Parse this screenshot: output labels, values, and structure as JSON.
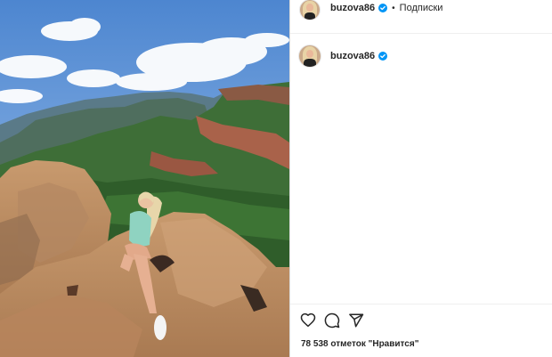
{
  "post": {
    "username": "buzova86",
    "follow_label": "Подписки",
    "separator": "•",
    "likes_text": "78 538 отметок \"Нравится\""
  },
  "comment": {
    "username": "buzova86"
  },
  "icons": {
    "verified": "verified-badge-icon",
    "like": "heart-icon",
    "comment": "comment-bubble-icon",
    "share": "paper-plane-icon"
  },
  "colors": {
    "verified": "#0095f6",
    "text": "#262626",
    "divider": "#efefef"
  }
}
